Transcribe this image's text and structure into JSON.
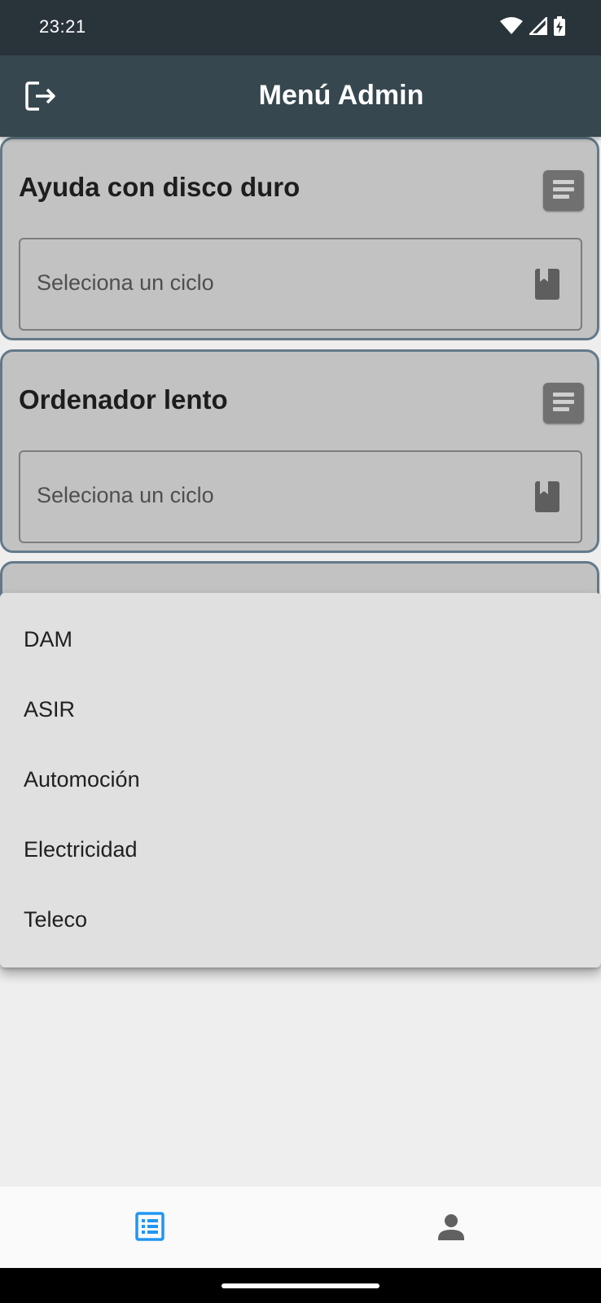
{
  "status_bar": {
    "time": "23:21"
  },
  "app_bar": {
    "title": "Menú Admin"
  },
  "cards": [
    {
      "title": "Ayuda con disco duro",
      "select_placeholder": "Seleciona un ciclo"
    },
    {
      "title": "Ordenador lento",
      "select_placeholder": "Seleciona un ciclo"
    }
  ],
  "dropdown": {
    "options": [
      "DAM",
      "ASIR",
      "Automoción",
      "Electricidad",
      "Teleco"
    ]
  },
  "bottom_nav": {
    "active_color": "#2196f3",
    "inactive_color": "#616161"
  },
  "colors": {
    "status_bar": "#29333a",
    "app_bar": "#37474f",
    "card_bg": "#c2c2c2",
    "card_border": "#63798a"
  }
}
